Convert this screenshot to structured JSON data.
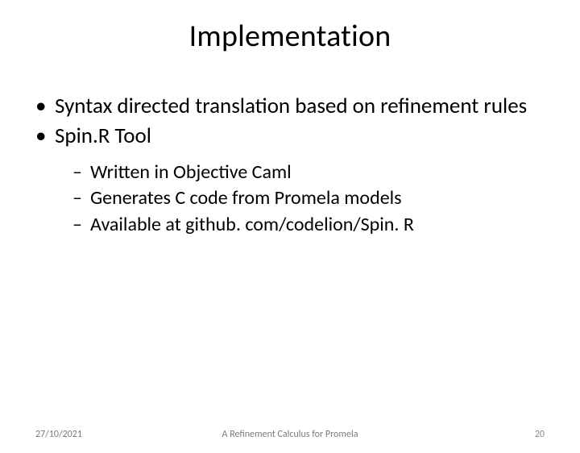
{
  "title": "Implementation",
  "bullets": {
    "items": [
      {
        "text": "Syntax directed translation based on refinement rules"
      },
      {
        "text": "Spin.R Tool"
      }
    ],
    "sub": [
      {
        "text": "Written in Objective Caml"
      },
      {
        "text": "Generates C code from Promela models"
      },
      {
        "text": "Available at github. com/codelion/Spin. R"
      }
    ]
  },
  "footer": {
    "date": "27/10/2021",
    "center": "A Refinement Calculus for Promela",
    "page": "20"
  }
}
